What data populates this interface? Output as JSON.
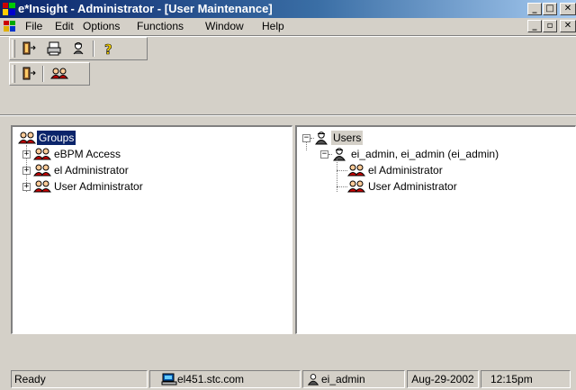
{
  "window": {
    "title": "e*Insight - Administrator - [User Maintenance]"
  },
  "menu": {
    "items": [
      "File",
      "Edit",
      "Options",
      "Functions",
      "Window",
      "Help"
    ]
  },
  "toolbar": {
    "icons": [
      "exit-icon",
      "print-icon",
      "user-search-icon",
      "help-icon"
    ]
  },
  "toolbar2": {
    "icons": [
      "exit-icon",
      "groups-icon"
    ]
  },
  "left_tree": {
    "root": "Groups",
    "children": [
      "eBPM Access",
      "el Administrator",
      "User Administrator"
    ]
  },
  "right_tree": {
    "root": "Users",
    "user": "ei_admin, ei_admin (ei_admin)",
    "user_groups": [
      "el Administrator",
      "User Administrator"
    ]
  },
  "status": {
    "state": "Ready",
    "host": "el451.stc.com",
    "user": "ei_admin",
    "date": "Aug-29-2002",
    "time": "12:15pm"
  }
}
